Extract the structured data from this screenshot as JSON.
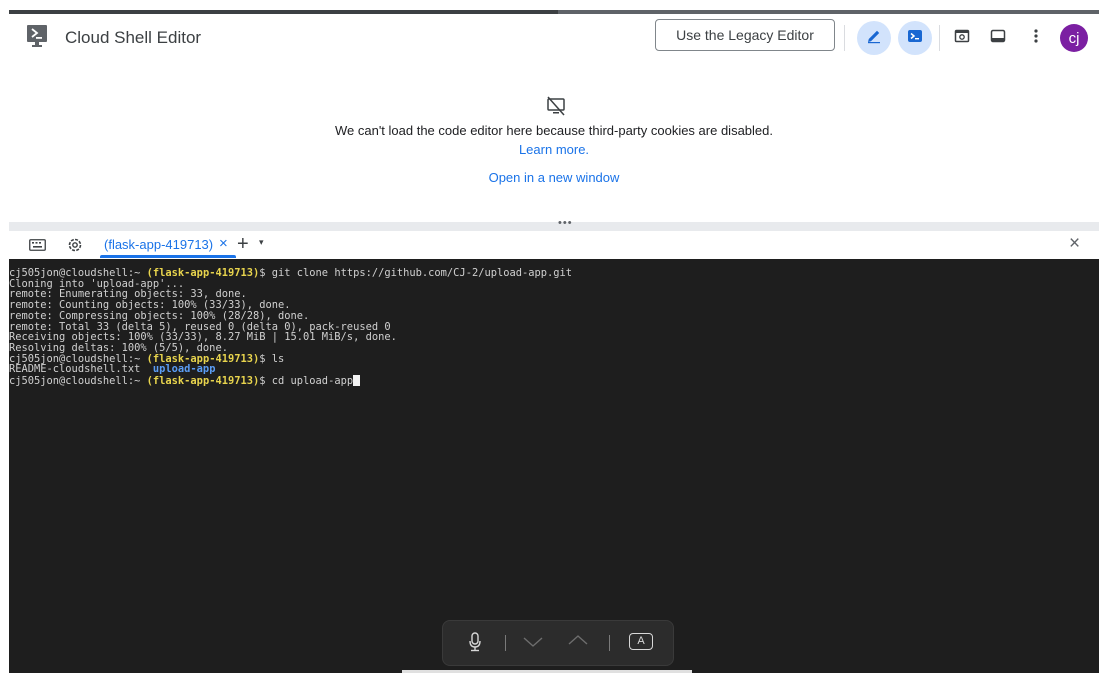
{
  "app": {
    "title": "Cloud Shell Editor"
  },
  "toolbar": {
    "legacy_button": "Use the Legacy Editor",
    "avatar_initials": "cj"
  },
  "editor": {
    "message": "We can't load the code editor here because third-party cookies are disabled.",
    "learn_more": "Learn more.",
    "open_window": "Open in a new window"
  },
  "terminal_tabs": {
    "active_tab": "(flask-app-419713)",
    "tab_close": "×",
    "add": "+",
    "dropdown": "▾",
    "close_panel": "×"
  },
  "terminal": {
    "lines": [
      {
        "user": "cj505jon@cloudshell:~ ",
        "project": "(flask-app-419713)",
        "cmd": "$ git clone https://github.com/CJ-2/upload-app.git"
      },
      {
        "text": "Cloning into 'upload-app'..."
      },
      {
        "text": "remote: Enumerating objects: 33, done."
      },
      {
        "text": "remote: Counting objects: 100% (33/33), done."
      },
      {
        "text": "remote: Compressing objects: 100% (28/28), done."
      },
      {
        "text": "remote: Total 33 (delta 5), reused 0 (delta 0), pack-reused 0"
      },
      {
        "text": "Receiving objects: 100% (33/33), 8.27 MiB | 15.01 MiB/s, done."
      },
      {
        "text": "Resolving deltas: 100% (5/5), done."
      },
      {
        "user": "cj505jon@cloudshell:~ ",
        "project": "(flask-app-419713)",
        "cmd": "$ ls"
      },
      {
        "file": "README-cloudshell.txt  ",
        "dir": "upload-app"
      },
      {
        "user": "cj505jon@cloudshell:~ ",
        "project": "(flask-app-419713)",
        "cmd": "$ cd upload-app",
        "cursor": true
      }
    ]
  },
  "floating_toolbar": {
    "icons": [
      "microphone-icon",
      "chevron-down-icon",
      "chevron-up-icon",
      "keyboard-a-icon"
    ],
    "key_label": "A"
  },
  "colors": {
    "accent": "#1a73e8",
    "terminal_bg": "#1e1e1e",
    "project": "#e8d44d",
    "directory": "#5b9df5",
    "avatar": "#7b1fa2"
  }
}
